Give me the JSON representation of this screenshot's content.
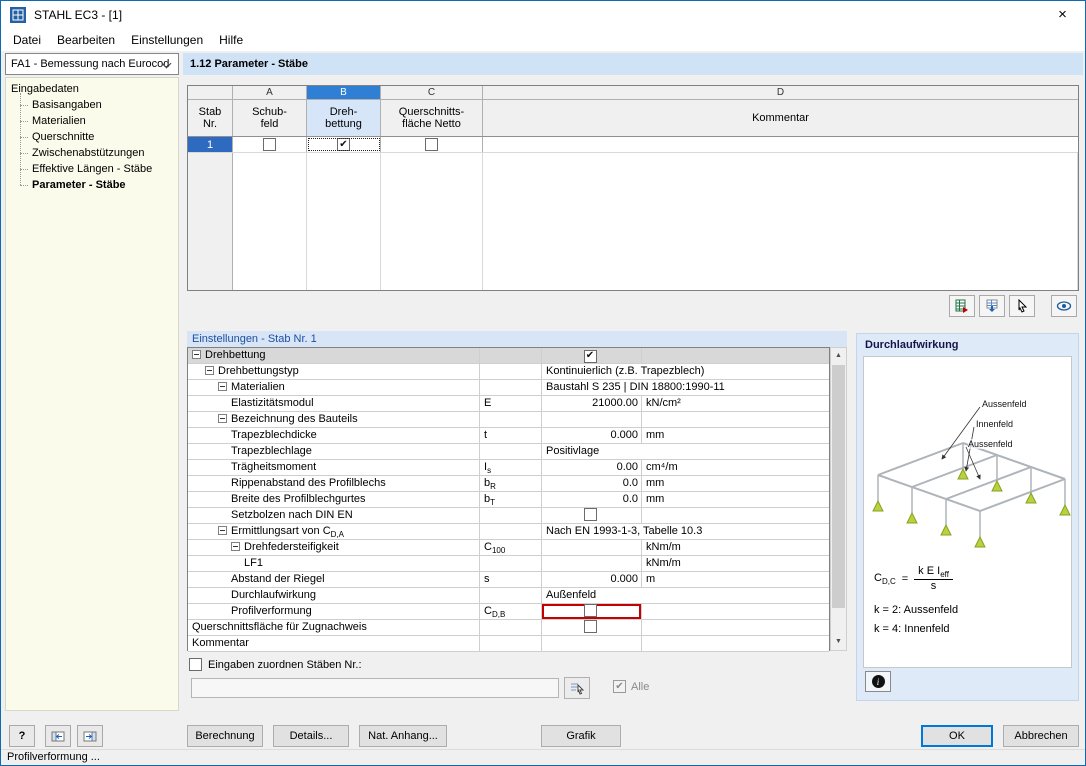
{
  "window": {
    "title": "STAHL EC3 - [1]",
    "close_glyph": "×"
  },
  "menu": {
    "items": [
      "Datei",
      "Bearbeiten",
      "Einstellungen",
      "Hilfe"
    ]
  },
  "navigator": {
    "dropdown_value": "FA1 - Bemessung nach Eurocod",
    "root": "Eingabedaten",
    "items": [
      "Basisangaben",
      "Materialien",
      "Querschnitte",
      "Zwischenabstützungen",
      "Effektive Längen - Stäbe",
      "Parameter - Stäbe"
    ],
    "selected": "Parameter - Stäbe"
  },
  "section_title": "1.12 Parameter - Stäbe",
  "main_table": {
    "column_letters": [
      "A",
      "B",
      "C",
      "D"
    ],
    "selected_column": "B",
    "headers": {
      "row_header": "Stab\nNr.",
      "col_a": "Schub-\nfeld",
      "col_b": "Dreh-\nbettung",
      "col_c": "Querschnitts-\nfläche Netto",
      "col_d": "Kommentar"
    },
    "rows": [
      {
        "nr": "1",
        "schubfeld": false,
        "drehbettung": true,
        "querschnittsflaeche_netto": false,
        "kommentar": ""
      }
    ]
  },
  "table_toolbar": {
    "icons": [
      "excel-export-icon",
      "table-export-icon",
      "pick-rows-icon",
      "view-graphic-icon"
    ]
  },
  "settings": {
    "title": "Einstellungen - Stab Nr. 1",
    "rows": [
      {
        "indent": 0,
        "expander": true,
        "label": "Drehbettung",
        "checkbox": true,
        "checked": true,
        "gray": true
      },
      {
        "indent": 1,
        "expander": true,
        "label": "Drehbettungstyp",
        "value": "Kontinuierlich (z.B. Trapezblech)",
        "span": true
      },
      {
        "indent": 2,
        "expander": true,
        "label": "Materialien",
        "value": "Baustahl S 235 | DIN 18800:1990-11",
        "span": true
      },
      {
        "indent": 3,
        "label": "Elastizitätsmodul",
        "sym": "E",
        "value": "21000.00",
        "unit": "kN/cm²"
      },
      {
        "indent": 2,
        "expander": true,
        "label": "Bezeichnung des Bauteils"
      },
      {
        "indent": 3,
        "label": "Trapezblechdicke",
        "sym": "t",
        "value": "0.000",
        "unit": "mm"
      },
      {
        "indent": 3,
        "label": "Trapezblechlage",
        "value": "Positivlage",
        "span": true
      },
      {
        "indent": 3,
        "label": "Trägheitsmoment",
        "sym": "I",
        "sym_sub": "s",
        "value": "0.00",
        "unit": "cm⁴/m"
      },
      {
        "indent": 3,
        "label": "Rippenabstand des Profilblechs",
        "sym": "b",
        "sym_sub": "R",
        "value": "0.0",
        "unit": "mm"
      },
      {
        "indent": 3,
        "label": "Breite des Profilblechgurtes",
        "sym": "b",
        "sym_sub": "T",
        "value": "0.0",
        "unit": "mm"
      },
      {
        "indent": 3,
        "label": "Setzbolzen nach DIN EN",
        "checkbox": true,
        "checked": false
      },
      {
        "indent": 2,
        "expander": true,
        "label": "Ermittlungsart von C",
        "label_sub": "D,A",
        "value": "Nach EN 1993-1-3, Tabelle 10.3",
        "span": true
      },
      {
        "indent": 3,
        "expander": true,
        "label": "Drehfedersteifigkeit",
        "sym": "C",
        "sym_sub": "100",
        "value": "",
        "unit": "kNm/m"
      },
      {
        "indent": 4,
        "label": "LF1",
        "value": "",
        "unit": "kNm/m"
      },
      {
        "indent": 3,
        "label": "Abstand der Riegel",
        "sym": "s",
        "value": "0.000",
        "unit": "m"
      },
      {
        "indent": 3,
        "label": "Durchlaufwirkung",
        "value": "Außenfeld",
        "span": true
      },
      {
        "indent": 3,
        "label": "Profilverformung",
        "sym": "C",
        "sym_sub": "D,B",
        "checkbox": true,
        "checked": false,
        "red": true
      },
      {
        "indent": 0,
        "label": "Querschnittsfläche für Zugnachweis",
        "checkbox": true,
        "checked": false
      },
      {
        "indent": 0,
        "label": "Kommentar"
      }
    ]
  },
  "assign": {
    "checkbox_label": "Eingaben zuordnen Stäben Nr.:",
    "checkbox_checked": false,
    "input_value": "",
    "alle_label": "Alle",
    "alle_checked": true
  },
  "info_panel": {
    "title": "Durchlaufwirkung",
    "diagram_labels": [
      "Aussenfeld",
      "Innenfeld",
      "Aussenfeld"
    ],
    "formula": {
      "lhs": "C",
      "lhs_sub": "D,C",
      "equals": "=",
      "numerator": "k E I",
      "numerator_sub": "eff",
      "denominator": "s"
    },
    "notes": [
      "k = 2: Aussenfeld",
      "k = 4: Innenfeld"
    ],
    "support_color": "#b9d23b"
  },
  "buttons": {
    "berechnung": "Berechnung",
    "details": "Details...",
    "nat_anhang": "Nat. Anhang...",
    "grafik": "Grafik",
    "ok": "OK",
    "abbrechen": "Abbrechen",
    "help": "?"
  },
  "status_bar": "Profilverformung ..."
}
